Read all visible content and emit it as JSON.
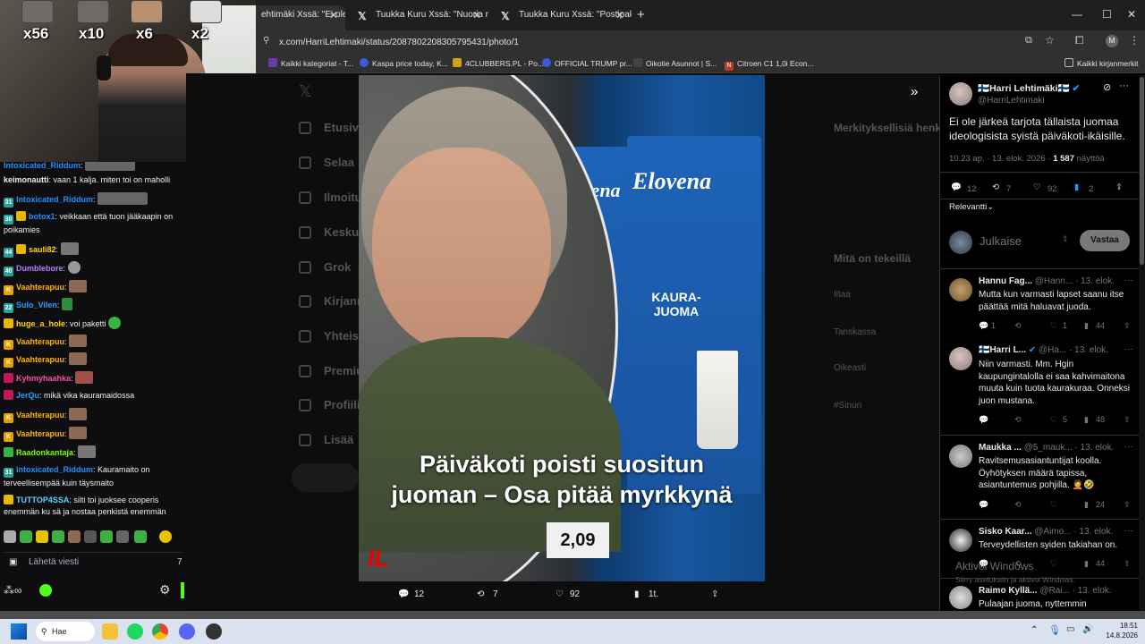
{
  "browser": {
    "tabs": [
      {
        "label": "ehtimäki Xssä: \"Ei ole",
        "active": true
      },
      {
        "label": "Tuukka Kuru Xssä: \"Nuoria mie",
        "active": false
      },
      {
        "label": "Tuukka Kuru Xssä: \"Postipaketi",
        "active": false
      }
    ],
    "url": "x.com/HarriLehtimaki/status/2087802208305795431/photo/1",
    "bookmarks": [
      "Kaikki kategoriat - T...",
      "Kaspa price today, K...",
      "4CLUBBERS.PL - Po...",
      "OFFICIAL TRUMP pr...",
      "Oikotie Asunnot | S...",
      "Citroen C1 1,0i Econ..."
    ],
    "all_bookmarks": "Kaikki kirjanmerkit",
    "profile_initial": "M"
  },
  "stream": {
    "multipliers": [
      "x56",
      "x10",
      "x6",
      "x2"
    ],
    "chat": [
      {
        "user": "Intoxicated_Riddum",
        "text": "",
        "color": "#1e90ff",
        "badge": ""
      },
      {
        "user": "keimonautti",
        "text": "vaan 1 kalja. miten toi on maholli",
        "color": "#ffffff",
        "badge": ""
      },
      {
        "user": "Intoxicated_Riddum",
        "text": "",
        "color": "#1e90ff",
        "badge": "31"
      },
      {
        "user": "botox1",
        "text": "veikkaan että tuon jääkaapin on poikamies",
        "color": "#1e90ff",
        "badge": "30"
      },
      {
        "user": "sauli82",
        "text": "",
        "color": "#ffd700",
        "badge": "44"
      },
      {
        "user": "Dumblebore",
        "text": "",
        "color": "#b07fff",
        "badge": "40"
      },
      {
        "user": "Vaahterapuu",
        "text": "",
        "color": "#ffb300",
        "badge": "K"
      },
      {
        "user": "Sulo_Vilen",
        "text": "",
        "color": "#2a9dff",
        "badge": "22"
      },
      {
        "user": "huge_a_hole",
        "text": "voi paketti",
        "color": "#ffd700",
        "badge": ""
      },
      {
        "user": "Vaahterapuu",
        "text": "",
        "color": "#ffb300",
        "badge": "K"
      },
      {
        "user": "Vaahterapuu",
        "text": "",
        "color": "#ffb300",
        "badge": "K"
      },
      {
        "user": "Kyhmyhaahka",
        "text": "",
        "color": "#ff4fa3",
        "badge": ""
      },
      {
        "user": "JerQu",
        "text": "mikä vika kauramaidossa",
        "color": "#2a9dff",
        "badge": ""
      },
      {
        "user": "Vaahterapuu",
        "text": "",
        "color": "#ffb300",
        "badge": "K"
      },
      {
        "user": "Vaahterapuu",
        "text": "",
        "color": "#ffb300",
        "badge": "K"
      },
      {
        "user": "Raadonkantaja",
        "text": "",
        "color": "#7CFC00",
        "badge": ""
      },
      {
        "user": "Intoxicated_Riddum",
        "text": "Kauramaito on terveellisempää kuin täysmaito",
        "color": "#1e90ff",
        "badge": "31"
      },
      {
        "user": "TUTTOP4SSA",
        "text": "silti toi juoksee cooperis enemmän ku sä ja nostaa penkistä enemmän",
        "color": "#5bd3ff",
        "badge": ""
      }
    ],
    "input_placeholder": "Lähetä viesti",
    "input_count": "7"
  },
  "x_background": {
    "nav": [
      "Etusivu",
      "Selaa",
      "Ilmoitukset",
      "Keskustelut",
      "Grok",
      "Kirjanmerkit",
      "Yhteisöt",
      "Premium",
      "Profiili",
      "Lisää"
    ],
    "trends_title": "Merkityksellisiä henkilöitä",
    "whats_happening": "Mitä on tekeillä",
    "trends": [
      "Iltaa",
      "Tanskassa",
      "Oikeasti",
      "#Sinun"
    ]
  },
  "photo": {
    "caption_line1": "Päiväkoti poisti suositun",
    "caption_line2": "juoman – Osa pitää myrkkynä",
    "logo": "IL",
    "brand": "Elovena",
    "product": "KAURA-JUOMA",
    "price": "2,09",
    "toolbar": {
      "replies": "12",
      "reposts": "7",
      "likes": "92",
      "views": "1t."
    }
  },
  "tweet": {
    "author": "🇫🇮Harri Lehtimäki🇫🇮",
    "handle": "@HarriLehtimaki",
    "text": "Ei ole järkeä tarjota tällaista juomaa ideologisista syistä päiväkoti-ikäisille.",
    "time": "10.23 ap. · 13. elok. 2026 · ",
    "views_count": "1 587",
    "views_label": " näyttöä",
    "stats": {
      "replies": "12",
      "reposts": "7",
      "likes": "92",
      "bookmarks": "2"
    },
    "sort": "Relevantti",
    "compose_placeholder": "Julkaise",
    "reply_button": "Vastaa"
  },
  "replies": [
    {
      "name": "Hannu Fag...",
      "handle": "@Hann...",
      "date": "· 13. elok.",
      "text": "Mutta kun varmasti lapset saanu itse päättää mitä haluavat juoda.",
      "stats": {
        "replies": "1",
        "reposts": "",
        "likes": "1",
        "views": "44"
      }
    },
    {
      "name": "🇫🇮Harri L...",
      "handle": "@Ha...",
      "date": "· 13. elok.",
      "text": "Niin varmasti. Mm. Hgin kaupungintalolla ei saa kahvimaitona muuta kuin tuota kaurakuraa. Onneksi juon mustana.",
      "stats": {
        "replies": "",
        "reposts": "",
        "likes": "5",
        "views": "48"
      }
    },
    {
      "name": "Maukka ...",
      "handle": "@5_mauk...",
      "date": "· 13. elok.",
      "text": "Ravitsemusasiantuntijat koolla. Öyhötyksen määrä tapissa, asiantuntemus pohjilla. 🤦🤣",
      "stats": {
        "replies": "",
        "reposts": "",
        "likes": "",
        "views": "24"
      }
    },
    {
      "name": "Sisko Kaar...",
      "handle": "@Aimo...",
      "date": "· 13. elok.",
      "text": "Terveydellisten syiden takiahan on.",
      "stats": {
        "replies": "",
        "reposts": "",
        "likes": "",
        "views": "44"
      }
    },
    {
      "name": "Raimo Kyllä...",
      "handle": "@Rai...",
      "date": "· 13. elok.",
      "text": "Pulaajan juoma, nyttemmin",
      "stats": {
        "replies": "",
        "reposts": "",
        "likes": "",
        "views": ""
      }
    }
  ],
  "windows": {
    "watermark_title": "Aktivoi Windows",
    "watermark_sub": "Siirry asetuksiin ja aktivoi Windows.",
    "search_label": "Hae",
    "time": "18.51",
    "date": "14.8.2026"
  }
}
